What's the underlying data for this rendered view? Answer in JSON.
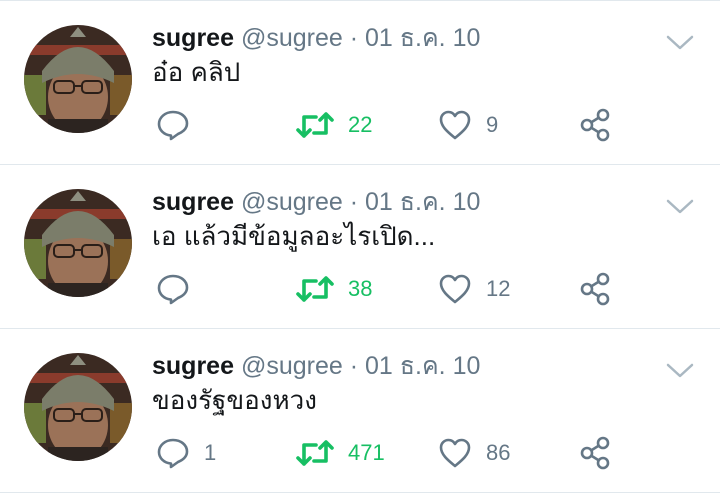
{
  "colors": {
    "retweet_active": "#17bf63",
    "secondary_text": "#657786",
    "icon_gray": "#657786",
    "divider": "#e1e8ed"
  },
  "tweets": [
    {
      "name": "sugree",
      "handle": "@sugree",
      "separator": "·",
      "date": "01 ธ.ค. 10",
      "text": "อ๋อ คลิป",
      "replies": "",
      "retweets": "22",
      "likes": "9",
      "retweeted": true
    },
    {
      "name": "sugree",
      "handle": "@sugree",
      "separator": "·",
      "date": "01 ธ.ค. 10",
      "text": "เอ แล้วมีข้อมูลอะไรเปิด...",
      "replies": "",
      "retweets": "38",
      "likes": "12",
      "retweeted": true
    },
    {
      "name": "sugree",
      "handle": "@sugree",
      "separator": "·",
      "date": "01 ธ.ค. 10",
      "text": "ของรัฐของหวง",
      "replies": "1",
      "retweets": "471",
      "likes": "86",
      "retweeted": true
    }
  ],
  "icons": {
    "reply": "reply-icon",
    "retweet": "retweet-icon",
    "like": "heart-icon",
    "share": "share-icon",
    "menu": "chevron-down-icon"
  }
}
